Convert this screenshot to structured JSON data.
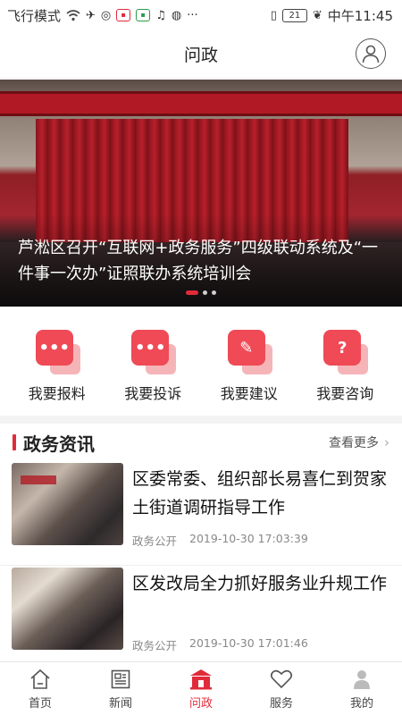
{
  "status_bar": {
    "left_text": "飞行模式",
    "battery": "21",
    "time": "中午11:45"
  },
  "header": {
    "title": "问政"
  },
  "banner": {
    "caption": "芦淞区召开“互联网+政务服务”四级联动系统及“一件事一次办”证照联办系统培训会",
    "slide_count": 3,
    "active_slide": 1
  },
  "actions": [
    {
      "label": "我要报料",
      "icon": "chat-dots-icon",
      "glyph": "•••"
    },
    {
      "label": "我要投诉",
      "icon": "complaint-message-icon",
      "glyph": "•••"
    },
    {
      "label": "我要建议",
      "icon": "pencil-suggestion-icon",
      "glyph": "✎"
    },
    {
      "label": "我要咨询",
      "icon": "question-icon",
      "glyph": "?"
    }
  ],
  "section": {
    "title": "政务资讯",
    "more": "查看更多"
  },
  "news": [
    {
      "title": "区委常委、组织部长易喜仁到贺家土街道调研指导工作",
      "tag": "政务公开",
      "time": "2019-10-30 17:03:39"
    },
    {
      "title": "区发改局全力抓好服务业升规工作",
      "tag": "政务公开",
      "time": "2019-10-30 17:01:46"
    }
  ],
  "tabs": [
    {
      "label": "首页",
      "icon": "home-icon"
    },
    {
      "label": "新闻",
      "icon": "news-icon"
    },
    {
      "label": "问政",
      "icon": "civic-building-icon"
    },
    {
      "label": "服务",
      "icon": "heart-icon"
    },
    {
      "label": "我的",
      "icon": "user-icon"
    }
  ],
  "active_tab": "问政",
  "colors": {
    "accent": "#e02b3a",
    "icon_red": "#ef4a56",
    "icon_pink": "#f5b5b8"
  }
}
